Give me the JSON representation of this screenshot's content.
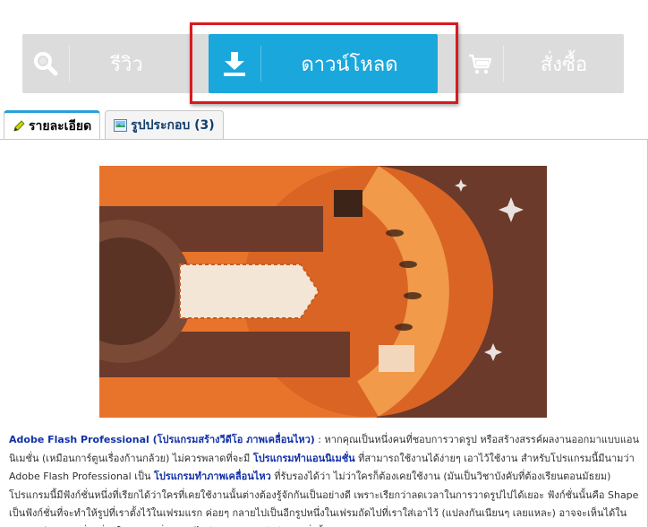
{
  "actions": {
    "review_label": "รีวิว",
    "download_label": "ดาวน์โหลด",
    "order_label": "สั่งซื้อ"
  },
  "tabs": [
    {
      "label": "รายละเอียด",
      "icon": "pencil-icon",
      "active": true
    },
    {
      "label": "รูปประกอบ (3)",
      "icon": "image-icon",
      "active": false
    }
  ],
  "description": {
    "title_link": "Adobe Flash Professional (โปรแกรมสร้างวีดีโอ ภาพเคลื่อนไหว)",
    "seg1": " : หากคุณเป็นหนึ่งคนที่ชอบการวาดรูป หรือสร้างสรรค์ผลงานออกมาแบบแอนนิเมชั่น (เหมือนการ์ตูนเรื่องก้านกล้วย) ไม่ควรพลาดที่จะมี ",
    "link1": "โปรแกรมทำแอนนิเมชั่น",
    "seg2": " ที่สามารถใช้งานได้ง่ายๆ เอาไว้ใช้งาน สำหรับโปรแกรมนี้มีนามว่า Adobe Flash Professional เป็น ",
    "link2": "โปรแกรมทำภาพเคลื่อนไหว",
    "seg3": " ที่รับรองได้ว่า ไม่ว่าใครก็ต้องเคยใช้งาน (มันเป็นวิชาบังคับที่ต้องเรียนตอนมัธยม) โปรแกรมนี้มีฟังก์ชั่นหนึ่งที่เรียกได้ว่าใครที่เคยใช้งานนั้นต่างต้องรู้จักกันเป็นอย่างดี เพราะเรียกว่าลดเวลาในการวาดรูปไปได้เยอะ ฟังก์ชั่นนั้นคือ Shape เป็นฟังก์ชั่นที่จะทำให้รูปที่เราตั้งไว้ในเฟรมแรก ค่อยๆ กลายไปเป็นอีกรูปหนึ่งในเฟรมถัดไปที่เราใส่เอาไว้ (แปลงกันเนียนๆ เลยแหละ) อาจจะเห็นได้ในภาพยนต์หลายๆ เรื่องที่ทำให้ตัวรถหนึ่ง กลายไปอีกตัวอักษร หรืออีกรูปหนึ่งนั้นเอง"
  },
  "colors": {
    "download_blue": "#1aa7dc",
    "highlight_red": "#d71a21",
    "link_blue": "#1231a8",
    "banner_orange": "#e8742c",
    "banner_brown": "#6b3a2a"
  }
}
